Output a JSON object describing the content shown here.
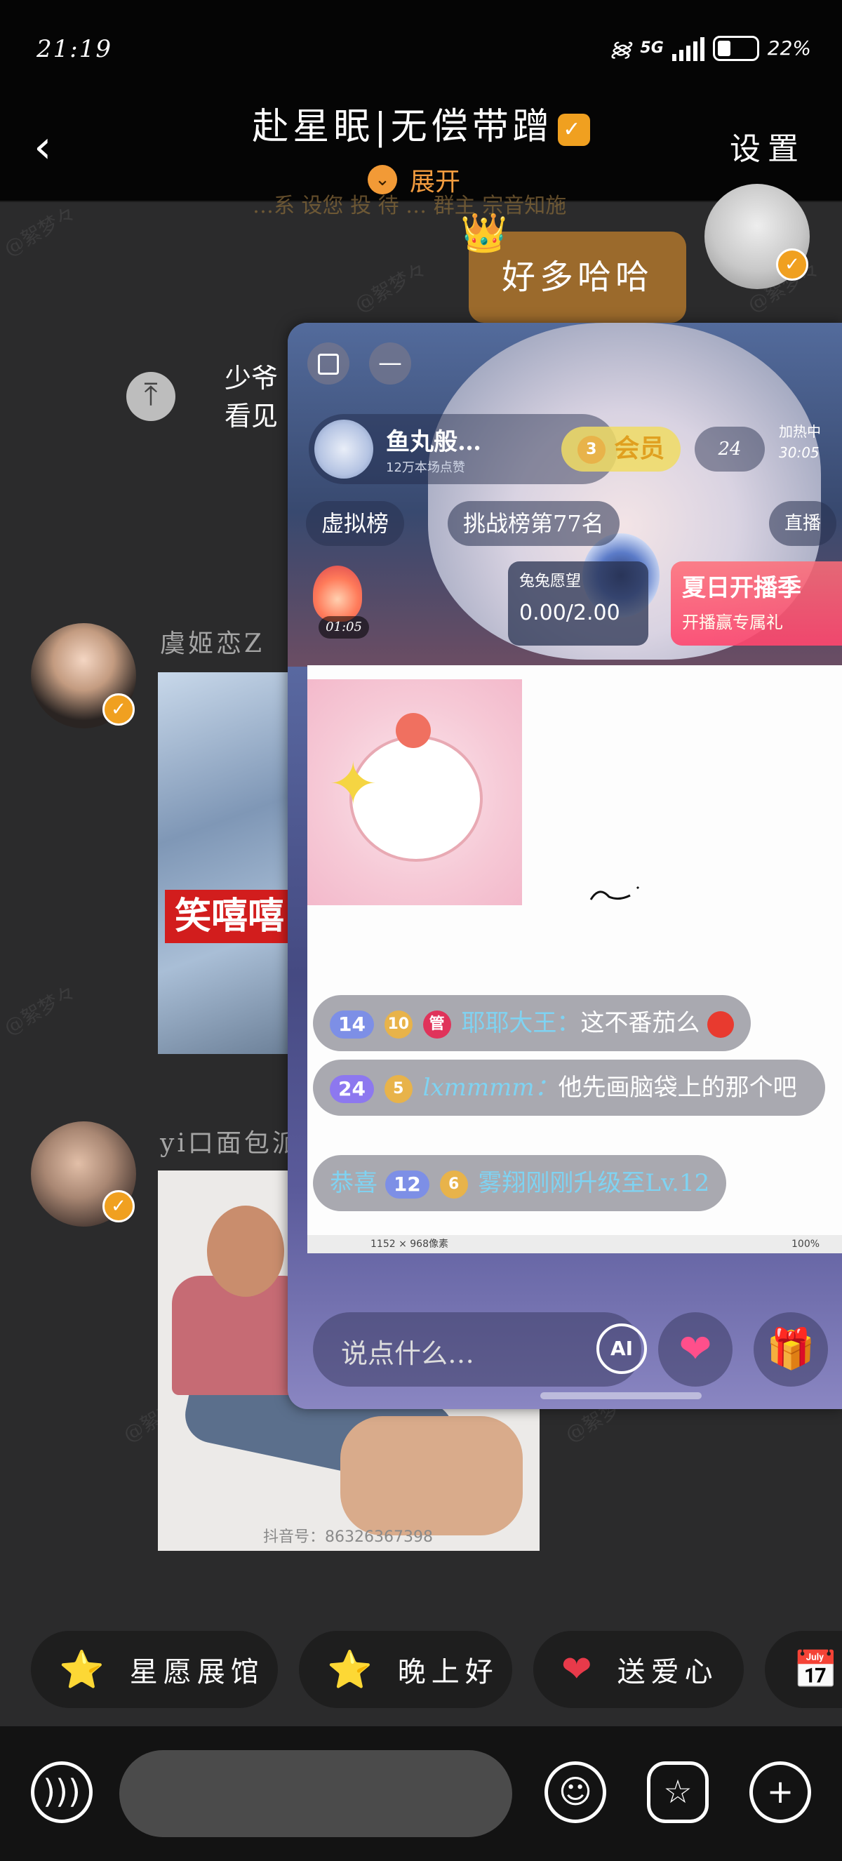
{
  "status_bar": {
    "time": "21:19",
    "network": "5G",
    "battery": "22%"
  },
  "header": {
    "back_icon": "chevron-left-icon",
    "title": "赴星眠|无偿带蹭",
    "expand_label": "展开",
    "settings_label": "设置"
  },
  "chat": {
    "faded_line": "…系 设您 投 待 … 群主 宗音知施",
    "my_bubble": "好多哈哈",
    "side_text_line1": "少爷",
    "side_text_line2": "看见",
    "watermark": "@絮梦々",
    "messages": [
      {
        "sender": "虞姬恋Z",
        "image_text": "笑嘻嘻"
      },
      {
        "sender": "yi口面包派",
        "image_caption": "抖音号：86326367398"
      }
    ]
  },
  "floating_window": {
    "streamer_name": "鱼丸般…",
    "streamer_sub": "12万本场点赞",
    "follow_label": "会员",
    "follow_badge": "3",
    "viewer_count": "24",
    "heat_label": "加热中",
    "heat_time": "30:05",
    "ranks": [
      "虚拟榜",
      "挑战榜第77名",
      "直播"
    ],
    "timer": "01:05",
    "wish_label": "兔兔愿望",
    "wish_value": "0.00/2.00",
    "summer_title": "夏日开播季",
    "summer_sub": "开播赢专属礼",
    "doc_status_size": "1152 × 968像素",
    "doc_status_zoom": "100%",
    "comments": [
      {
        "level": "14",
        "fan_level": "10",
        "role": "管",
        "user": "耶耶大王：",
        "text": "这不番茄么"
      },
      {
        "level": "24",
        "fan_level": "5",
        "user": "lxmmmm：",
        "text": "他先画脑袋上的那个吧"
      },
      {
        "prefix": "恭喜",
        "level": "12",
        "fan_level": "6",
        "text": "雾翔刚刚升级至Lv.12"
      }
    ],
    "input_placeholder": "说点什么…",
    "ai_label": "AI"
  },
  "quick_replies": [
    {
      "icon": "star-face-icon",
      "label": "星愿展馆"
    },
    {
      "icon": "star-face-icon",
      "label": "晚上好"
    },
    {
      "icon": "heart-icon",
      "label": "送爱心"
    }
  ],
  "bottom_bar": {
    "voice_icon": "voice-icon",
    "emoji_icon": "emoji-icon",
    "sticker_icon": "sticker-icon",
    "plus_icon": "plus-icon"
  }
}
